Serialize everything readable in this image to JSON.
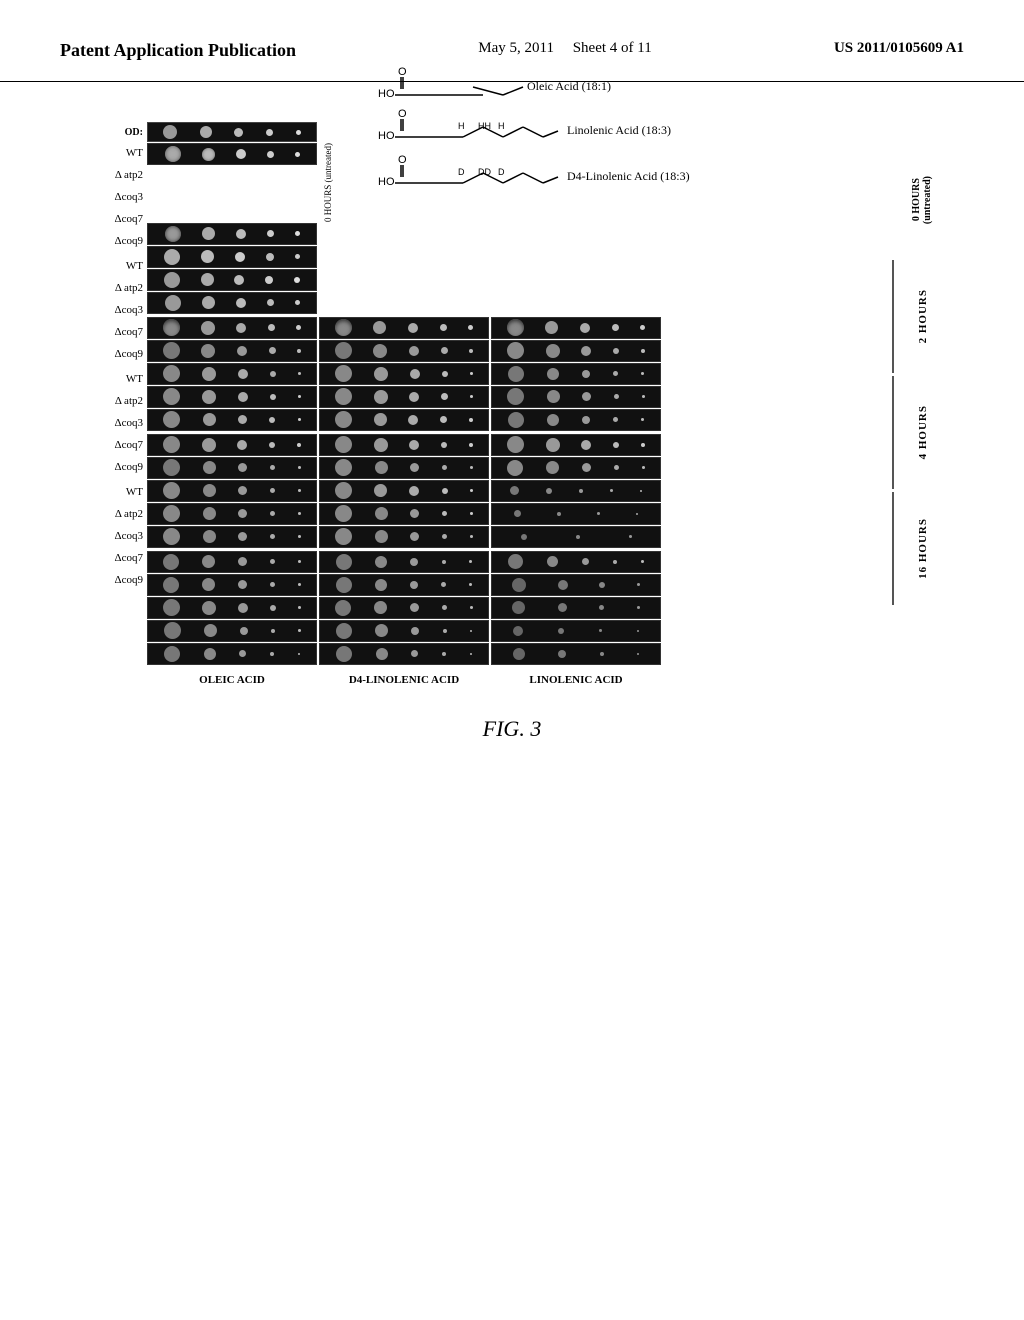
{
  "header": {
    "left": "Patent Application Publication",
    "center_date": "May 5, 2011",
    "center_sheet": "Sheet 4 of 11",
    "right": "US 2011/0105609 A1"
  },
  "figure": {
    "caption": "FIG. 3",
    "chemicals": [
      {
        "name": "Oleic Acid (18:1)",
        "formula_note": "HO-C=O chain"
      },
      {
        "name": "Linolenic Acid (18:3)",
        "formula_note": "HO-C=O chain with H HH H"
      },
      {
        "name": "D4-Linolenic Acid (18:3)",
        "formula_note": "HO-C=O chain with D DD D"
      }
    ],
    "row_labels": {
      "od": "OD:",
      "wt": "WT",
      "atp2": "Δ atp2",
      "coq3": "Δcoq3",
      "coq7": "Δcoq7",
      "coq9": "Δcoq9"
    },
    "col_labels": [
      "OLEIC ACID",
      "D4-LINOLENIC ACID",
      "LINOLENIC ACID"
    ],
    "hour_labels": [
      "0 HOURS\n(untreated)",
      "2 HOURS",
      "4 HOURS",
      "16 HOURS"
    ],
    "sections": [
      {
        "hours": "0 HOURS\n(untreated)",
        "label": "0 HOURS",
        "sublabel": "(untreated)"
      },
      {
        "hours": "2 HOURS"
      },
      {
        "hours": "4 HOURS"
      },
      {
        "hours": "16 HOURS"
      }
    ]
  }
}
